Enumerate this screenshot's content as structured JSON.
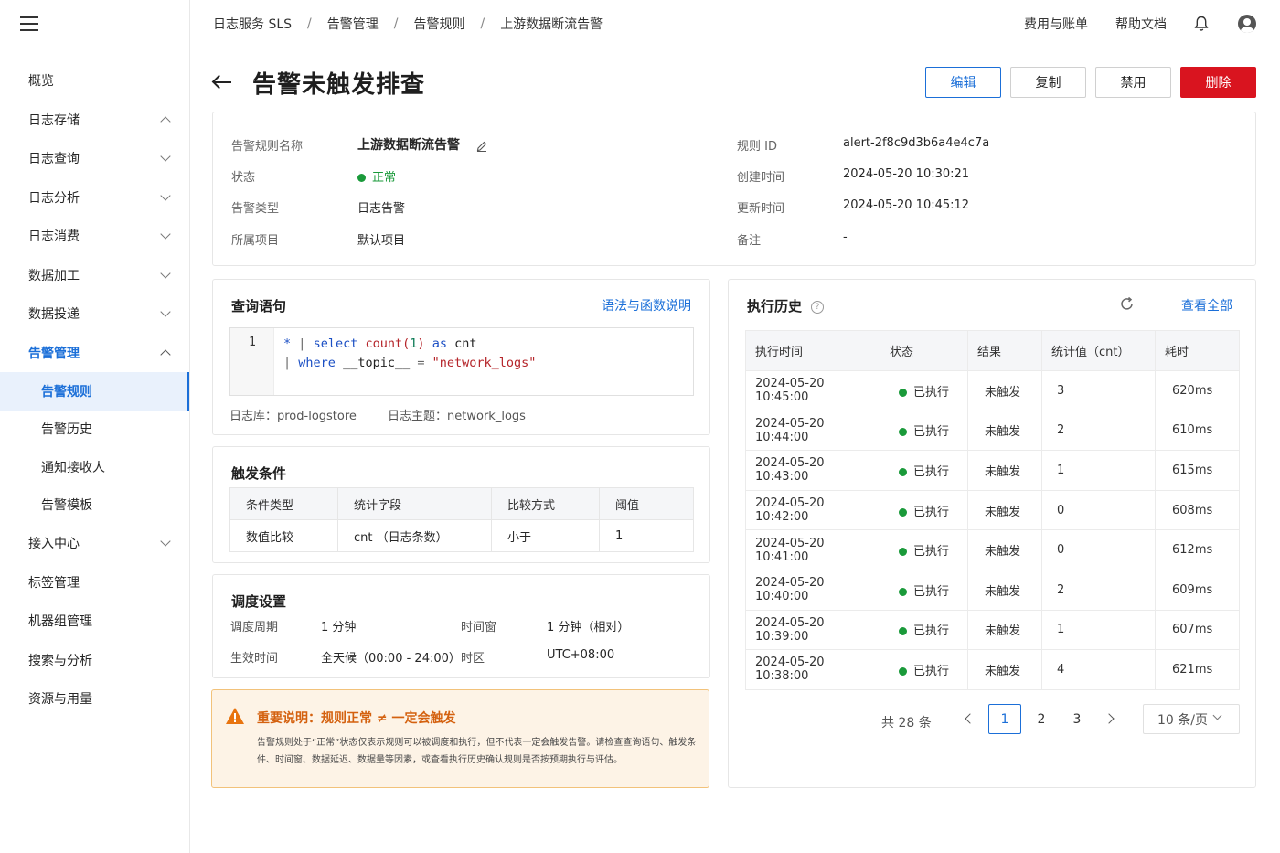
{
  "topbar": {
    "breadcrumbs": [
      "日志服务 SLS",
      "告警管理",
      "告警规则",
      "上游数据断流告警"
    ],
    "billing": "费用与账单",
    "help": "帮助文档"
  },
  "sidebar": {
    "items": [
      {
        "label": "概览"
      },
      {
        "label": "日志存储"
      },
      {
        "label": "日志查询"
      },
      {
        "label": "日志分析"
      },
      {
        "label": "日志消费"
      },
      {
        "label": "数据加工"
      },
      {
        "label": "数据投递"
      },
      {
        "label": "告警管理"
      },
      {
        "label": "告警规则"
      },
      {
        "label": "告警历史"
      },
      {
        "label": "通知接收人"
      },
      {
        "label": "告警模板"
      },
      {
        "label": "接入中心"
      },
      {
        "label": "标签管理"
      },
      {
        "label": "机器组管理"
      },
      {
        "label": "搜索与分析"
      },
      {
        "label": "资源与用量"
      }
    ]
  },
  "header": {
    "title": "告警未触发排查",
    "buttons": {
      "edit": "编辑",
      "copy": "复制",
      "disable": "禁用",
      "delete": "删除"
    }
  },
  "info": {
    "name_label": "告警规则名称",
    "name_value": "上游数据断流告警",
    "status_label": "状态",
    "status_value": "正常",
    "type_label": "告警类型",
    "type_value": "日志告警",
    "project_label": "所属项目",
    "project_value": "默认项目",
    "id_label": "规则 ID",
    "id_value": "alert-2f8c9d3b6a4e4c7a",
    "created_label": "创建时间",
    "created_value": "2024-05-20 10:30:21",
    "updated_label": "更新时间",
    "updated_value": "2024-05-20 10:45:12",
    "note_label": "备注",
    "note_value": "-"
  },
  "query": {
    "title": "查询语句",
    "link": "语法与函数说明",
    "line_number": "1",
    "line1": {
      "star": "*",
      "pipe": "|",
      "select": "select",
      "count": "count(",
      "one": "1",
      "close": ")",
      "as": "as",
      "cnt": "cnt"
    },
    "line2": {
      "pipe": "|",
      "where": "where",
      "field": "__topic__",
      "eq": "=",
      "value": "\"network_logs\""
    },
    "logstore": "日志库：prod-logstore",
    "topic": "日志主题：network_logs"
  },
  "trigger": {
    "title": "触发条件",
    "headers": [
      "条件类型",
      "统计字段",
      "比较方式",
      "阈值"
    ],
    "row": [
      "数值比较",
      "cnt （日志条数）",
      "小于",
      "1"
    ]
  },
  "schedule": {
    "title": "调度设置",
    "period_label": "调度周期",
    "period_value": "1 分钟",
    "window_label": "时间窗",
    "window_value": "1 分钟（相对）",
    "effective_label": "生效时间",
    "effective_value": "全天候（00:00 - 24:00）",
    "tz_label": "时区",
    "tz_value": "UTC+08:00"
  },
  "notice": {
    "title": "重要说明：规则正常 ≠ 一定会触发",
    "body": "告警规则处于“正常”状态仅表示规则可以被调度和执行，但不代表一定会触发告警。请检查查询语句、触发条件、时间窗、数据延迟、数据量等因素，或查看执行历史确认规则是否按预期执行与评估。"
  },
  "history": {
    "title": "执行历史",
    "view_all": "查看全部",
    "headers": [
      "执行时间",
      "状态",
      "结果",
      "统计值（cnt）",
      "耗时"
    ],
    "rows": [
      {
        "time": "2024-05-20 10:45:00",
        "status": "已执行",
        "result": "未触发",
        "value": "3",
        "cost": "620ms"
      },
      {
        "time": "2024-05-20 10:44:00",
        "status": "已执行",
        "result": "未触发",
        "value": "2",
        "cost": "610ms"
      },
      {
        "time": "2024-05-20 10:43:00",
        "status": "已执行",
        "result": "未触发",
        "value": "1",
        "cost": "615ms"
      },
      {
        "time": "2024-05-20 10:42:00",
        "status": "已执行",
        "result": "未触发",
        "value": "0",
        "cost": "608ms"
      },
      {
        "time": "2024-05-20 10:41:00",
        "status": "已执行",
        "result": "未触发",
        "value": "0",
        "cost": "612ms"
      },
      {
        "time": "2024-05-20 10:40:00",
        "status": "已执行",
        "result": "未触发",
        "value": "2",
        "cost": "609ms"
      },
      {
        "time": "2024-05-20 10:39:00",
        "status": "已执行",
        "result": "未触发",
        "value": "1",
        "cost": "607ms"
      },
      {
        "time": "2024-05-20 10:38:00",
        "status": "已执行",
        "result": "未触发",
        "value": "4",
        "cost": "621ms"
      }
    ],
    "pager": {
      "total": "共 28 条",
      "pages": [
        "1",
        "2",
        "3"
      ],
      "size": "10 条/页"
    }
  },
  "colors": {
    "accent": "#1b6fd8",
    "danger": "#d9141f",
    "success": "#1a9a3a",
    "warning": "#d4610f"
  }
}
